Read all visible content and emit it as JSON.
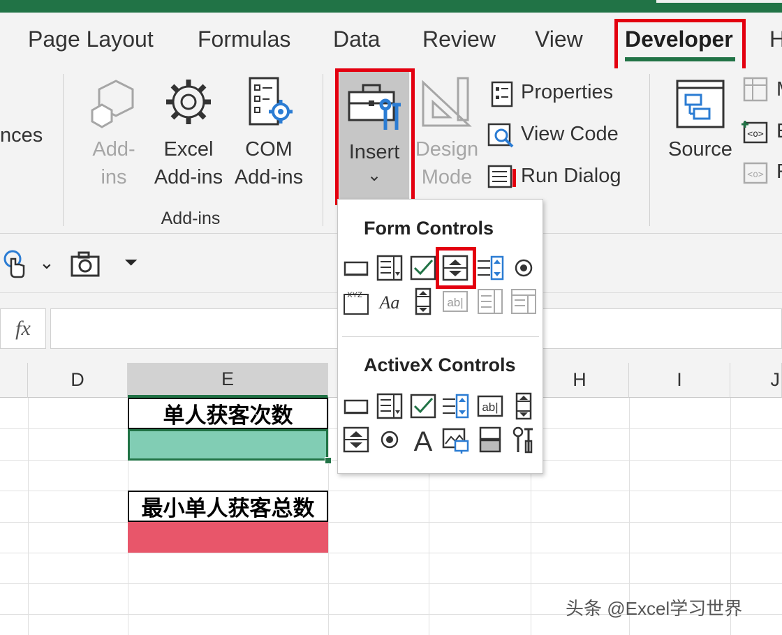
{
  "tabs": [
    "Page Layout",
    "Formulas",
    "Data",
    "Review",
    "View",
    "Developer",
    "H"
  ],
  "ribbon": {
    "partial_left_label": "nces",
    "addins_label": "Add-\nins",
    "excel_addins_label": "Excel\nAdd-ins",
    "com_addins_label": "COM\nAdd-ins",
    "group_label": "Add-ins",
    "insert_label": "Insert",
    "insert_chevron": "⌄",
    "design_mode_label": "Design\nMode",
    "properties_label": "Properties",
    "view_code_label": "View Code",
    "run_dialog_label": "Run Dialog",
    "source_label": "Source",
    "partial_right_1": "M",
    "partial_right_2": "E",
    "partial_right_3": "R"
  },
  "qat": {
    "chevron": "⌄",
    "customize": "⏷"
  },
  "formula_bar": {
    "fx": "fx",
    "value": ""
  },
  "grid": {
    "columns": [
      "D",
      "E",
      "H",
      "I",
      "J"
    ],
    "cells": {
      "e1": "单人获客次数",
      "e4": "最小单人获客总数"
    },
    "colors": {
      "green_cell": "#81cdb4",
      "red_cell": "#e8566a"
    }
  },
  "dropdown": {
    "form_title": "Form Controls",
    "activex_title": "ActiveX Controls",
    "form_controls": [
      "button",
      "combo-box",
      "check-box",
      "spin-button",
      "list-box",
      "option-button",
      "group-box",
      "label",
      "scroll-bar",
      "text-field",
      "combo-list-edit",
      "combo-drop-down-edit"
    ],
    "activex_controls": [
      "command-button",
      "combo-box",
      "check-box",
      "list-box",
      "text-box",
      "scroll-bar",
      "spin-button",
      "option-button",
      "label",
      "image",
      "toggle-button",
      "more-controls"
    ]
  },
  "watermark": "头条 @Excel学习世界",
  "colors": {
    "accent": "#217346",
    "highlight": "#e3000f"
  }
}
